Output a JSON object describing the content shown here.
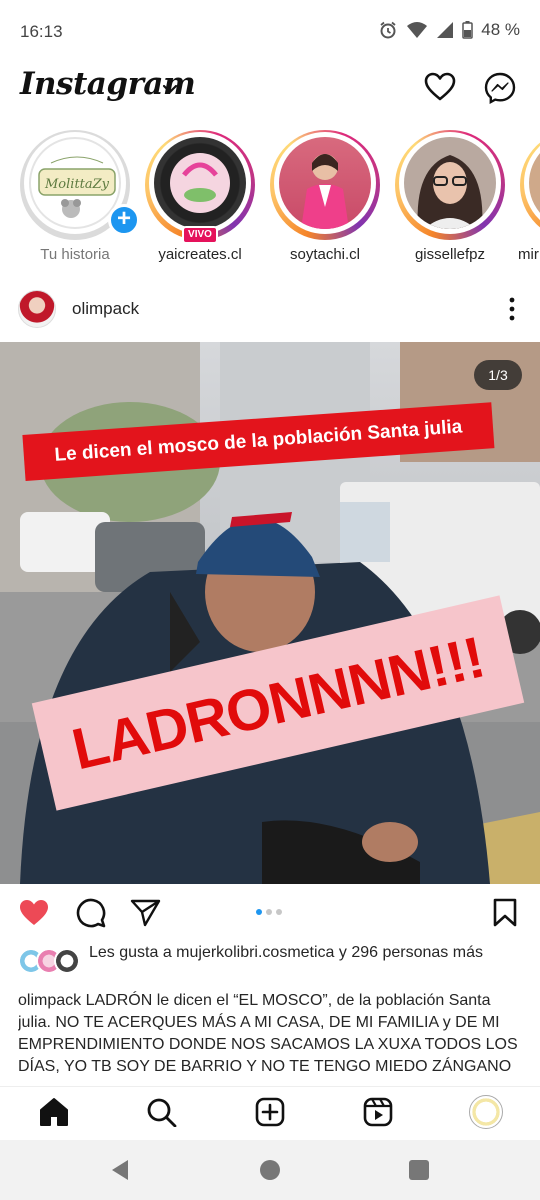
{
  "status_bar": {
    "time": "16:13",
    "battery": "48 %",
    "icons": [
      "alarm-icon",
      "wifi-icon",
      "signal-icon",
      "battery-icon"
    ]
  },
  "header": {
    "logo": "Instagram",
    "icons": [
      "chevron-down-icon",
      "heart-icon",
      "messenger-icon"
    ]
  },
  "stories": [
    {
      "name": "Tu historia",
      "profile_text": "MolittaZy",
      "own": true
    },
    {
      "name": "yaicreates.cl",
      "live_label": "VIVO"
    },
    {
      "name": "soytachi.cl"
    },
    {
      "name": "gissellefpz"
    },
    {
      "name": "mir"
    }
  ],
  "post": {
    "username": "olimpack",
    "counter": "1/3",
    "image_caption_top": "Le dicen el mosco de la población Santa julia",
    "image_caption_main": "LADRONNNN!!!",
    "carousel": {
      "total": 3,
      "active": 1
    },
    "liked": true,
    "likes_text": "Les gusta a mujerkolibri.cosmetica y 296 personas más",
    "caption": "olimpack LADRÓN le dicen el “EL MOSCO”, de la población Santa julia. NO TE ACERQUES MÁS A MI CASA, DE MI FAMILIA y DE MI EMPRENDIMIENTO DONDE NOS SACAMOS LA XUXA TODOS LOS DÍAS, YO TB SOY DE BARRIO Y NO TE TENGO MIEDO ZÁNGANO"
  },
  "bottom_nav": [
    "home-icon",
    "search-icon",
    "create-icon",
    "reels-icon",
    "profile-avatar"
  ],
  "colors": {
    "like_red": "#ed4956",
    "accent_blue": "#1d96f0",
    "caption_red": "#e3141c",
    "caption_pink": "#f6c5cb"
  }
}
